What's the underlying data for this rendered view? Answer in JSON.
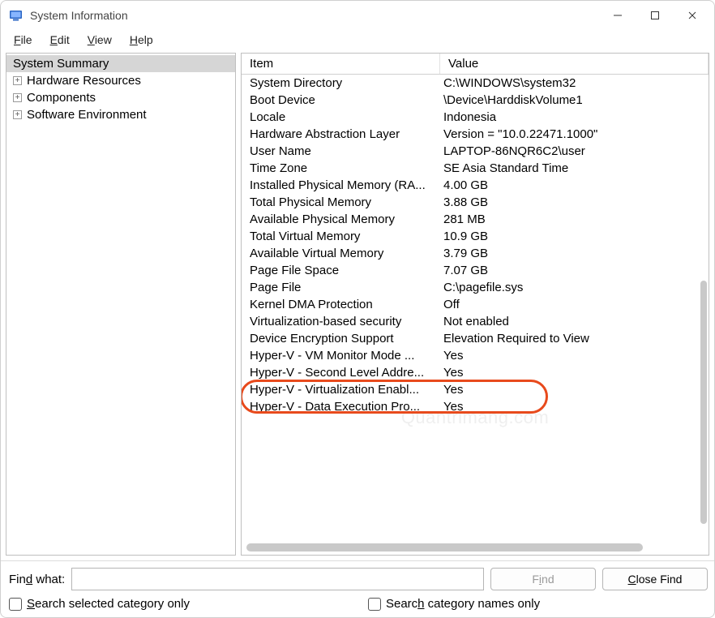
{
  "window": {
    "title": "System Information"
  },
  "menu": {
    "file": "File",
    "edit": "Edit",
    "view": "View",
    "help": "Help"
  },
  "tree": {
    "root": "System Summary",
    "children": [
      "Hardware Resources",
      "Components",
      "Software Environment"
    ]
  },
  "grid": {
    "headers": {
      "item": "Item",
      "value": "Value"
    },
    "rows": [
      {
        "item": "System Directory",
        "value": "C:\\WINDOWS\\system32"
      },
      {
        "item": "Boot Device",
        "value": "\\Device\\HarddiskVolume1"
      },
      {
        "item": "Locale",
        "value": "Indonesia"
      },
      {
        "item": "Hardware Abstraction Layer",
        "value": "Version = \"10.0.22471.1000\""
      },
      {
        "item": "User Name",
        "value": "LAPTOP-86NQR6C2\\user"
      },
      {
        "item": "Time Zone",
        "value": "SE Asia Standard Time"
      },
      {
        "item": "Installed Physical Memory (RA...",
        "value": "4.00 GB"
      },
      {
        "item": "Total Physical Memory",
        "value": "3.88 GB"
      },
      {
        "item": "Available Physical Memory",
        "value": "281 MB"
      },
      {
        "item": "Total Virtual Memory",
        "value": "10.9 GB"
      },
      {
        "item": "Available Virtual Memory",
        "value": "3.79 GB"
      },
      {
        "item": "Page File Space",
        "value": "7.07 GB"
      },
      {
        "item": "Page File",
        "value": "C:\\pagefile.sys"
      },
      {
        "item": "Kernel DMA Protection",
        "value": "Off"
      },
      {
        "item": "Virtualization-based security",
        "value": "Not enabled"
      },
      {
        "item": "Device Encryption Support",
        "value": "Elevation Required to View"
      },
      {
        "item": "Hyper-V - VM Monitor Mode ...",
        "value": "Yes"
      },
      {
        "item": "Hyper-V - Second Level Addre...",
        "value": "Yes"
      },
      {
        "item": "Hyper-V - Virtualization Enabl...",
        "value": "Yes"
      },
      {
        "item": "Hyper-V - Data Execution Pro...",
        "value": "Yes"
      }
    ]
  },
  "search": {
    "label": "Find what:",
    "placeholder": "",
    "find": "Find",
    "close": "Close Find",
    "opt1": "Search selected category only",
    "opt2": "Search category names only"
  },
  "watermark": "Quantrimang.com"
}
